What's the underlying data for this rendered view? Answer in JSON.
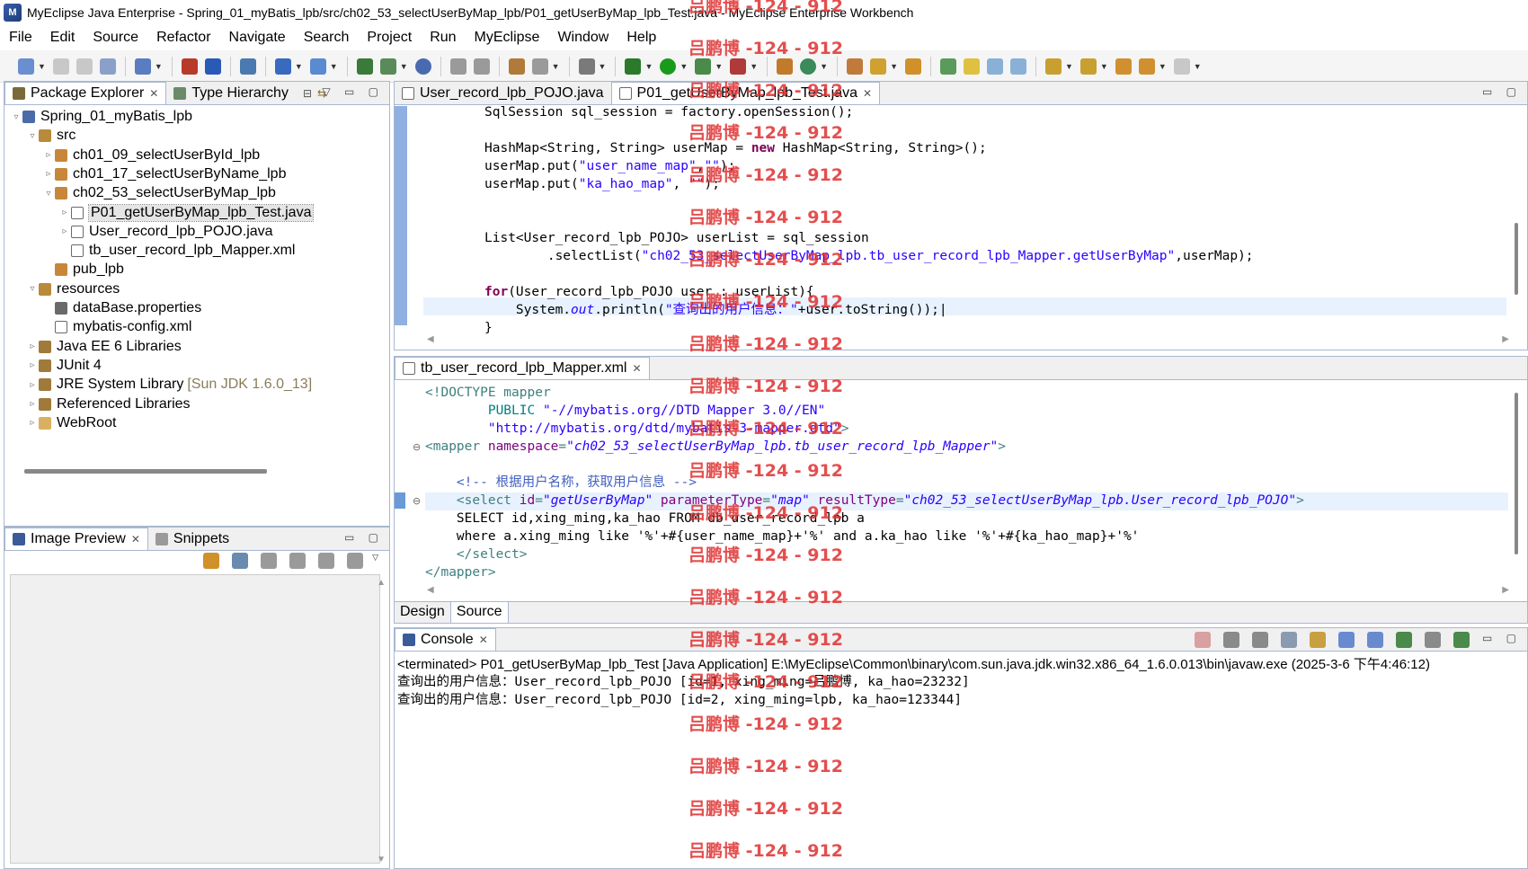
{
  "window": {
    "title": "MyEclipse Java Enterprise - Spring_01_myBatis_lpb/src/ch02_53_selectUserByMap_lpb/P01_getUserByMap_lpb_Test.java - MyEclipse Enterprise Workbench"
  },
  "menu": [
    "File",
    "Edit",
    "Source",
    "Refactor",
    "Navigate",
    "Search",
    "Project",
    "Run",
    "MyEclipse",
    "Window",
    "Help"
  ],
  "left_panel": {
    "tabs": [
      "Package Explorer",
      "Type Hierarchy"
    ],
    "tree": [
      {
        "label": "Spring_01_myBatis_lpb",
        "indent": 0,
        "arrow": "▿",
        "icon": "project-icon"
      },
      {
        "label": "src",
        "indent": 1,
        "arrow": "▿",
        "icon": "source-folder-icon"
      },
      {
        "label": "ch01_09_selectUserById_lpb",
        "indent": 2,
        "arrow": "▹",
        "icon": "package-icon"
      },
      {
        "label": "ch01_17_selectUserByName_lpb",
        "indent": 2,
        "arrow": "▹",
        "icon": "package-icon"
      },
      {
        "label": "ch02_53_selectUserByMap_lpb",
        "indent": 2,
        "arrow": "▿",
        "icon": "package-icon"
      },
      {
        "label": "P01_getUserByMap_lpb_Test.java",
        "indent": 3,
        "arrow": "▹",
        "icon": "java-file-icon",
        "selected": true
      },
      {
        "label": "User_record_lpb_POJO.java",
        "indent": 3,
        "arrow": "▹",
        "icon": "java-file-icon"
      },
      {
        "label": "tb_user_record_lpb_Mapper.xml",
        "indent": 3,
        "arrow": "",
        "icon": "xml-file-icon"
      },
      {
        "label": "pub_lpb",
        "indent": 2,
        "arrow": "",
        "icon": "package-icon"
      },
      {
        "label": "resources",
        "indent": 1,
        "arrow": "▿",
        "icon": "source-folder-icon"
      },
      {
        "label": "dataBase.properties",
        "indent": 2,
        "arrow": "",
        "icon": "properties-file-icon"
      },
      {
        "label": "mybatis-config.xml",
        "indent": 2,
        "arrow": "",
        "icon": "xml-file-icon"
      },
      {
        "label": "Java EE 6 Libraries",
        "indent": 1,
        "arrow": "▹",
        "icon": "library-icon"
      },
      {
        "label": "JUnit 4",
        "indent": 1,
        "arrow": "▹",
        "icon": "library-icon"
      },
      {
        "label": "JRE System Library",
        "suffix": "[Sun JDK 1.6.0_13]",
        "indent": 1,
        "arrow": "▹",
        "icon": "library-icon"
      },
      {
        "label": "Referenced Libraries",
        "indent": 1,
        "arrow": "▹",
        "icon": "library-icon"
      },
      {
        "label": "WebRoot",
        "indent": 1,
        "arrow": "▹",
        "icon": "folder-icon"
      }
    ]
  },
  "bottom_left_panel": {
    "tabs": [
      "Image Preview",
      "Snippets"
    ]
  },
  "editor_top": {
    "tabs": [
      "User_record_lpb_POJO.java",
      "P01_getUserByMap_lpb_Test.java"
    ]
  },
  "editor_xml": {
    "tab": "tb_user_record_lpb_Mapper.xml",
    "bottom_tabs": [
      "Design",
      "Source"
    ]
  },
  "console": {
    "tab": "Console",
    "header": "<terminated> P01_getUserByMap_lpb_Test [Java Application] E:\\MyEclipse\\Common\\binary\\com.sun.java.jdk.win32.x86_64_1.6.0.013\\bin\\javaw.exe (2025-3-6 下午4:46:12)",
    "lines": [
      "查询出的用户信息：User_record_lpb_POJO [id=1, xing_ming=吕鹏博, ka_hao=23232]",
      "查询出的用户信息：User_record_lpb_POJO [id=2, xing_ming=lpb, ka_hao=123344]"
    ]
  },
  "watermark_text": "吕鹏博 -124 - 912"
}
